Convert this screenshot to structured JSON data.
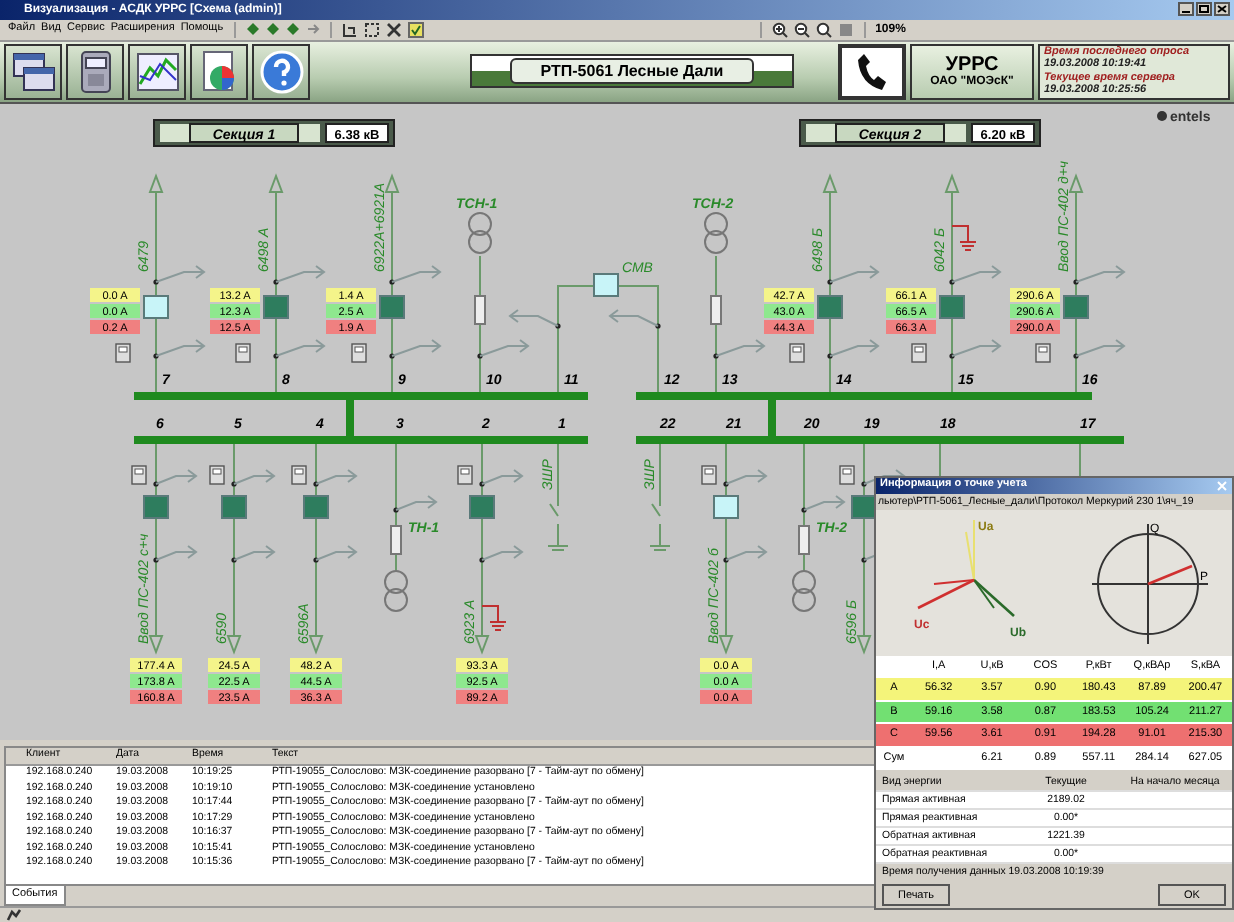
{
  "window": {
    "title": "Визуализация - АСДК УРРС [Схема (admin)]"
  },
  "menu": [
    "Файл",
    "Вид",
    "Сервис",
    "Расширения",
    "Помощь"
  ],
  "zoom": "109%",
  "header": {
    "title": "РТП-5061 Лесные Дали",
    "org_name": "УРРС",
    "org_company": "ОАО \"МОЭсК\"",
    "last_poll_label": "Время последнего опроса",
    "last_poll_time": "19.03.2008 10:19:41",
    "server_time_label": "Текущее время сервера",
    "server_time": "19.03.2008 10:25:56"
  },
  "logo": "entels",
  "sections": [
    {
      "name": "Секция 1",
      "voltage": "6.38 кВ"
    },
    {
      "name": "Секция 2",
      "voltage": "6.20 кВ"
    }
  ],
  "tie": {
    "label": "СМВ",
    "on": false
  },
  "upper_feeders": [
    {
      "kind": "line",
      "number": "7",
      "name": "6479",
      "on": false,
      "grounded": false,
      "readings": [
        "0.0 A",
        "0.0 A",
        "0.2 A"
      ]
    },
    {
      "kind": "line",
      "number": "8",
      "name": "6498 А",
      "on": true,
      "grounded": false,
      "readings": [
        "13.2 A",
        "12.3 A",
        "12.5 A"
      ]
    },
    {
      "kind": "line",
      "number": "9",
      "name": "6922А+6921А",
      "on": true,
      "grounded": false,
      "readings": [
        "1.4 A",
        "2.5 A",
        "1.9 A"
      ]
    },
    {
      "kind": "tsn",
      "number": "10",
      "name": "ТСН-1"
    },
    {
      "kind": "tie",
      "number": "11"
    },
    {
      "kind": "tie",
      "number": "12"
    },
    {
      "kind": "tsn",
      "number": "13",
      "name": "ТСН-2"
    },
    {
      "kind": "line",
      "number": "14",
      "name": "6498 Б",
      "on": true,
      "grounded": false,
      "readings": [
        "42.7 A",
        "43.0 A",
        "44.3 A"
      ]
    },
    {
      "kind": "line",
      "number": "15",
      "name": "6042 Б",
      "on": true,
      "grounded": true,
      "readings": [
        "66.1 A",
        "66.5 A",
        "66.3 A"
      ]
    },
    {
      "kind": "line",
      "number": "16",
      "name": "Ввод ПС-402 д+ч",
      "on": true,
      "grounded": false,
      "readings": [
        "290.6 A",
        "290.6 A",
        "290.0 A"
      ]
    }
  ],
  "lower_feeders": [
    {
      "kind": "line",
      "number": "6",
      "name": "Ввод ПС-402 с+ч",
      "on": true,
      "grounded": false,
      "readings": [
        "177.4 A",
        "173.8 A",
        "160.8 A"
      ]
    },
    {
      "kind": "line",
      "number": "5",
      "name": "6590",
      "on": true,
      "grounded": false,
      "readings": [
        "24.5 A",
        "22.5 A",
        "23.5 A"
      ]
    },
    {
      "kind": "line",
      "number": "4",
      "name": "6596А",
      "on": true,
      "grounded": false,
      "readings": [
        "48.2 A",
        "44.5 A",
        "36.3 A"
      ]
    },
    {
      "kind": "tn",
      "number": "3",
      "name": "ТН-1"
    },
    {
      "kind": "line",
      "number": "2",
      "name": "6923 А",
      "on": true,
      "grounded": true,
      "readings": [
        "93.3 A",
        "92.5 A",
        "89.2 A"
      ]
    },
    {
      "kind": "earth_switch",
      "number": "1",
      "name": "ЗШР"
    },
    {
      "kind": "earth_switch",
      "number": "22",
      "name": "ЗШР"
    },
    {
      "kind": "line",
      "number": "21",
      "name": "Ввод ПС-402 б",
      "on": false,
      "grounded": false,
      "readings": [
        "0.0 A",
        "0.0 A",
        "0.0 A"
      ]
    },
    {
      "kind": "tn",
      "number": "20",
      "name": "ТН-2"
    },
    {
      "kind": "line",
      "number": "19",
      "name": "6596 Б",
      "on": true,
      "grounded": false
    },
    {
      "kind": "stub",
      "number": "18"
    },
    {
      "kind": "stub",
      "number": "17"
    }
  ],
  "info_dialog": {
    "title": "Информация о точке учета",
    "path": "льютер\\РТП-5061_Лесные_дали\\Протокол Меркурий 230 1\\яч_19",
    "vector_labels": [
      "Ua",
      "Ub",
      "Uc"
    ],
    "circle_labels": [
      "Q",
      "P"
    ],
    "columns": [
      "I,A",
      "U,кВ",
      "COS",
      "P,кВт",
      "Q,кВАр",
      "S,кВА"
    ],
    "rows": [
      {
        "phase": "A",
        "color": "#f4f47a",
        "values": [
          "56.32",
          "3.57",
          "0.90",
          "180.43",
          "87.89",
          "200.47"
        ]
      },
      {
        "phase": "B",
        "color": "#72e072",
        "values": [
          "59.16",
          "3.58",
          "0.87",
          "183.53",
          "105.24",
          "211.27"
        ]
      },
      {
        "phase": "C",
        "color": "#ee7070",
        "values": [
          "59.56",
          "3.61",
          "0.91",
          "194.28",
          "91.01",
          "215.30"
        ]
      },
      {
        "phase": "Сум",
        "color": "#ffffff",
        "values": [
          "6.21",
          "0.89",
          "557.11",
          "284.14",
          "627.05"
        ]
      }
    ],
    "energy_columns": [
      "Вид энергии",
      "Текущие",
      "На начало месяца"
    ],
    "energy_rows": [
      [
        "Прямая активная",
        "2189.02"
      ],
      [
        "Прямая реактивная",
        "0.00*"
      ],
      [
        "Обратная активная",
        "1221.39"
      ],
      [
        "Обратная реактивная",
        "0.00*"
      ]
    ],
    "timestamp": "Время получения данных  19.03.2008 10:19:39",
    "buttons": [
      "Печать",
      "OK"
    ]
  },
  "event_log": {
    "columns": [
      "Клиент",
      "Дата",
      "Время",
      "Текст"
    ],
    "rows": [
      [
        "192.168.0.240",
        "19.03.2008",
        "10:19:25",
        "РТП-19055_Солослово: МЗК-соединение разорвано [7 - Тайм-аут по обмену]"
      ],
      [
        "192.168.0.240",
        "19.03.2008",
        "10:19:10",
        "РТП-19055_Солослово: МЗК-соединение установлено"
      ],
      [
        "192.168.0.240",
        "19.03.2008",
        "10:17:44",
        "РТП-19055_Солослово: МЗК-соединение разорвано [7 - Тайм-аут по обмену]"
      ],
      [
        "192.168.0.240",
        "19.03.2008",
        "10:17:29",
        "РТП-19055_Солослово: МЗК-соединение установлено"
      ],
      [
        "192.168.0.240",
        "19.03.2008",
        "10:16:37",
        "РТП-19055_Солослово: МЗК-соединение разорвано [7 - Тайм-аут по обмену]"
      ],
      [
        "192.168.0.240",
        "19.03.2008",
        "10:15:41",
        "РТП-19055_Солослово: МЗК-соединение установлено"
      ],
      [
        "192.168.0.240",
        "19.03.2008",
        "10:15:36",
        "РТП-19055_Солослово: МЗК-соединение разорвано [7 - Тайм-аут по обмену]"
      ]
    ]
  },
  "bottom_tabs": [
    {
      "label": "События",
      "selected": true
    }
  ]
}
